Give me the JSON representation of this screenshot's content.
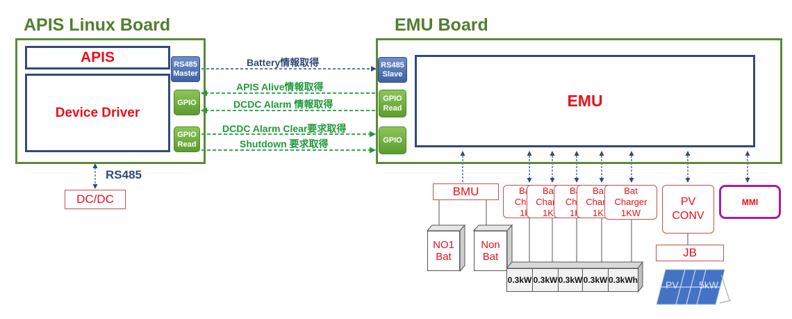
{
  "apis_board": {
    "title": "APIS Linux Board",
    "apis_label": "APIS",
    "driver_label": "Device Driver",
    "rs485_chip": [
      "RS485",
      "Master"
    ],
    "gpio_chip": "GPIO",
    "gpio_read_chip": [
      "GPIO",
      "Read"
    ],
    "rs485_label": "RS485",
    "dcdc_label": "DC/DC"
  },
  "emu_board": {
    "title": "EMU Board",
    "emu_label": "EMU",
    "rs485_slave_chip": [
      "RS485",
      "Slave"
    ],
    "gpio_read_chip": [
      "GPIO",
      "Read"
    ],
    "gpio_chip": "GPIO"
  },
  "signals": {
    "battery": "Battery情報取得",
    "alive": "APIS Alive情報取得",
    "dcdc_alarm": "DCDC Alarm 情報取得",
    "alarm_clear": "DCDC Alarm Clear要求取得",
    "shutdown": "Shutdown 要求取得"
  },
  "peripherals": {
    "bmu": "BMU",
    "no1_bat": [
      "NO1",
      "Bat"
    ],
    "non_bat": [
      "Non",
      "Bat"
    ],
    "chargers": [
      [
        "Ba",
        "Char",
        "1k"
      ],
      [
        "Ba",
        "Charg",
        "1K"
      ],
      [
        "Ba",
        "Char",
        "1K"
      ],
      [
        "Ba",
        "Charg",
        "1K"
      ],
      [
        "Bat",
        "Charger",
        "1KW"
      ]
    ],
    "cells": [
      "0.3kW",
      "0.3kW",
      "0.3kW",
      "0.3kW",
      "0.3kWh"
    ],
    "pv_conv": [
      "PV",
      "CONV"
    ],
    "jb": "JB",
    "pv_panel": [
      "PV",
      "5kW"
    ],
    "mmi": "MMI"
  },
  "colors": {
    "board_green": "#5a8a3a",
    "navy": "#2f4a7c",
    "red": "#e8101a",
    "signal_green": "#1e9a3a",
    "mmi_purple": "#a020a0"
  }
}
